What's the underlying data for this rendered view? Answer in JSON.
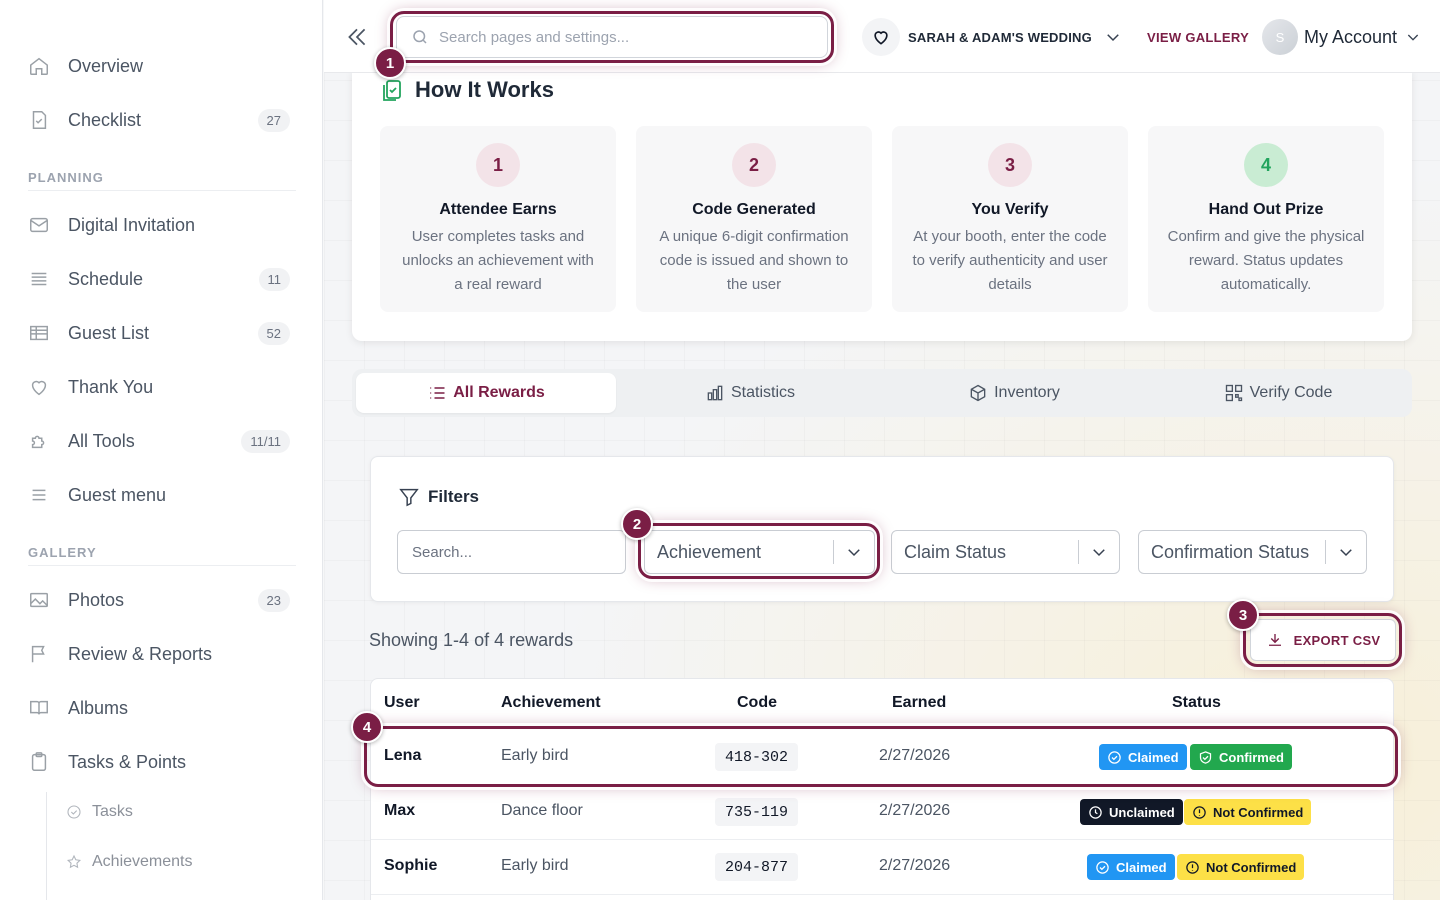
{
  "sidebar": {
    "items": [
      {
        "label": "Overview",
        "icon": "home-icon",
        "count": ""
      },
      {
        "label": "Checklist",
        "icon": "checklist-icon",
        "count": "27"
      }
    ],
    "planning_header": "PLANNING",
    "planning": [
      {
        "label": "Digital Invitation",
        "icon": "mail-icon",
        "count": ""
      },
      {
        "label": "Schedule",
        "icon": "schedule-icon",
        "count": "11"
      },
      {
        "label": "Guest List",
        "icon": "table-icon",
        "count": "52"
      },
      {
        "label": "Thank You",
        "icon": "heart-icon",
        "count": ""
      },
      {
        "label": "All Tools",
        "icon": "puzzle-icon",
        "count": "11/11"
      },
      {
        "label": "Guest menu",
        "icon": "menu-icon",
        "count": ""
      }
    ],
    "gallery_header": "GALLERY",
    "gallery": [
      {
        "label": "Photos",
        "icon": "photo-icon",
        "count": "23"
      },
      {
        "label": "Review & Reports",
        "icon": "flag-icon",
        "count": ""
      },
      {
        "label": "Albums",
        "icon": "book-icon",
        "count": ""
      },
      {
        "label": "Tasks & Points",
        "icon": "clipboard-icon",
        "count": ""
      }
    ],
    "subitems": [
      {
        "label": "Tasks",
        "icon": "check-circle-icon"
      },
      {
        "label": "Achievements",
        "icon": "star-icon"
      }
    ]
  },
  "header": {
    "search_placeholder": "Search pages and settings...",
    "event_name": "SARAH & ADAM'S WEDDING",
    "view_gallery": "VIEW GALLERY",
    "avatar_initial": "S",
    "account_label": "My Account"
  },
  "how_it_works": {
    "title": "How It Works",
    "steps": [
      {
        "num": "1",
        "title": "Attendee Earns",
        "desc": "User completes tasks and unlocks an achievement with a real reward"
      },
      {
        "num": "2",
        "title": "Code Generated",
        "desc": "A unique 6-digit confirmation code is issued and shown to the user"
      },
      {
        "num": "3",
        "title": "You Verify",
        "desc": "At your booth, enter the code to verify authenticity and user details"
      },
      {
        "num": "4",
        "title": "Hand Out Prize",
        "desc": "Confirm and give the physical reward. Status updates automatically."
      }
    ]
  },
  "tabs": [
    {
      "label": "All Rewards",
      "icon": "list-icon"
    },
    {
      "label": "Statistics",
      "icon": "bar-chart-icon"
    },
    {
      "label": "Inventory",
      "icon": "box-icon"
    },
    {
      "label": "Verify Code",
      "icon": "qr-icon"
    }
  ],
  "filters": {
    "title": "Filters",
    "search_placeholder": "Search...",
    "achievement": "Achievement",
    "claim_status": "Claim Status",
    "confirmation_status": "Confirmation Status"
  },
  "results": {
    "showing": "Showing 1-4 of 4 rewards",
    "export": "EXPORT CSV"
  },
  "table": {
    "columns": [
      "User",
      "Achievement",
      "Code",
      "Earned",
      "Status"
    ],
    "rows": [
      {
        "user": "Lena",
        "achievement": "Early bird",
        "code": "418-302",
        "earned": "2/27/2026",
        "claim": "Claimed",
        "confirm": "Confirmed"
      },
      {
        "user": "Max",
        "achievement": "Dance floor",
        "code": "735-119",
        "earned": "2/27/2026",
        "claim": "Unclaimed",
        "confirm": "Not Confirmed"
      },
      {
        "user": "Sophie",
        "achievement": "Early bird",
        "code": "204-877",
        "earned": "2/27/2026",
        "claim": "Claimed",
        "confirm": "Not Confirmed"
      }
    ]
  },
  "annotations": [
    "1",
    "2",
    "3",
    "4"
  ],
  "colors": {
    "accent": "#7a1e45",
    "success": "#22a84e",
    "info": "#2196f3",
    "warning": "#fde047"
  }
}
